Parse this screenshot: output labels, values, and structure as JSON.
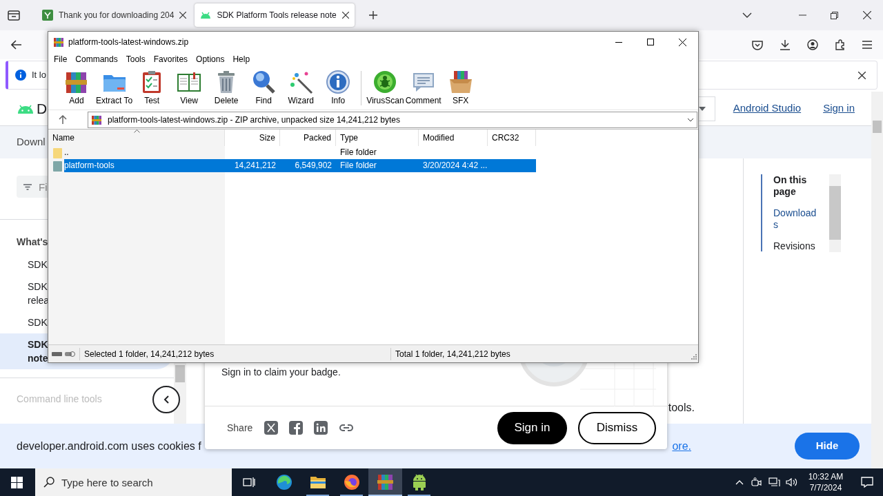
{
  "browser": {
    "tabs": [
      {
        "title": "Thank you for downloading 204",
        "selected": false
      },
      {
        "title": "SDK Platform Tools release note",
        "selected": true
      }
    ],
    "notice": {
      "text": "It lo"
    },
    "site_header": {
      "logo_text": "D",
      "links": [
        {
          "label": "Android Studio"
        },
        {
          "label": "Sign in"
        }
      ]
    },
    "breadcrumb": "Downl",
    "filter": {
      "placeholder": "Fi"
    },
    "sidebar": {
      "heading": "What's",
      "items": [
        {
          "label": "SDK",
          "selected": false
        },
        {
          "label": "SDK relea",
          "selected": false
        },
        {
          "label": "SDK",
          "selected": false
        },
        {
          "label": "SDK note",
          "selected": true
        }
      ],
      "footer_item": "Command line tools"
    },
    "toc": {
      "title": "On this page",
      "items": [
        {
          "label": "Downloads",
          "selected": true
        },
        {
          "label": "Revisions",
          "selected": false
        }
      ]
    },
    "body_text": "tools.",
    "badge_popup": {
      "message": "Sign in to claim your badge.",
      "share_label": "Share",
      "primary_button": "Sign in",
      "secondary_button": "Dismiss"
    },
    "cookie_banner": {
      "text": "developer.android.com uses cookies f",
      "link": "ore.",
      "button": "Hide"
    }
  },
  "archiver": {
    "title": "platform-tools-latest-windows.zip",
    "menu": [
      "File",
      "Commands",
      "Tools",
      "Favorites",
      "Options",
      "Help"
    ],
    "toolbar": [
      {
        "label": "Add"
      },
      {
        "label": "Extract To"
      },
      {
        "label": "Test"
      },
      {
        "label": "View"
      },
      {
        "label": "Delete"
      },
      {
        "label": "Find"
      },
      {
        "label": "Wizard"
      },
      {
        "label": "Info"
      },
      {
        "label": "VirusScan"
      },
      {
        "label": "Comment"
      },
      {
        "label": "SFX"
      }
    ],
    "path": "platform-tools-latest-windows.zip - ZIP archive, unpacked size 14,241,212 bytes",
    "columns": [
      "Name",
      "Size",
      "Packed",
      "Type",
      "Modified",
      "CRC32"
    ],
    "rows": [
      {
        "name": "..",
        "type": "File folder",
        "selected": false
      },
      {
        "name": "platform-tools",
        "size": "14,241,212",
        "packed": "6,549,902",
        "type": "File folder",
        "modified": "3/20/2024 4:42 ...",
        "selected": true
      }
    ],
    "status": {
      "selection": "Selected 1 folder, 14,241,212 bytes",
      "total": "Total 1 folder, 14,241,212 bytes"
    }
  },
  "taskbar": {
    "search_placeholder": "Type here to search",
    "apps": [
      {
        "running": false,
        "selected": false
      },
      {
        "running": true,
        "selected": false
      },
      {
        "running": true,
        "selected": false
      },
      {
        "running": true,
        "selected": true
      },
      {
        "running": true,
        "selected": false
      }
    ],
    "time": "10:32 AM",
    "date": "7/7/2024"
  }
}
